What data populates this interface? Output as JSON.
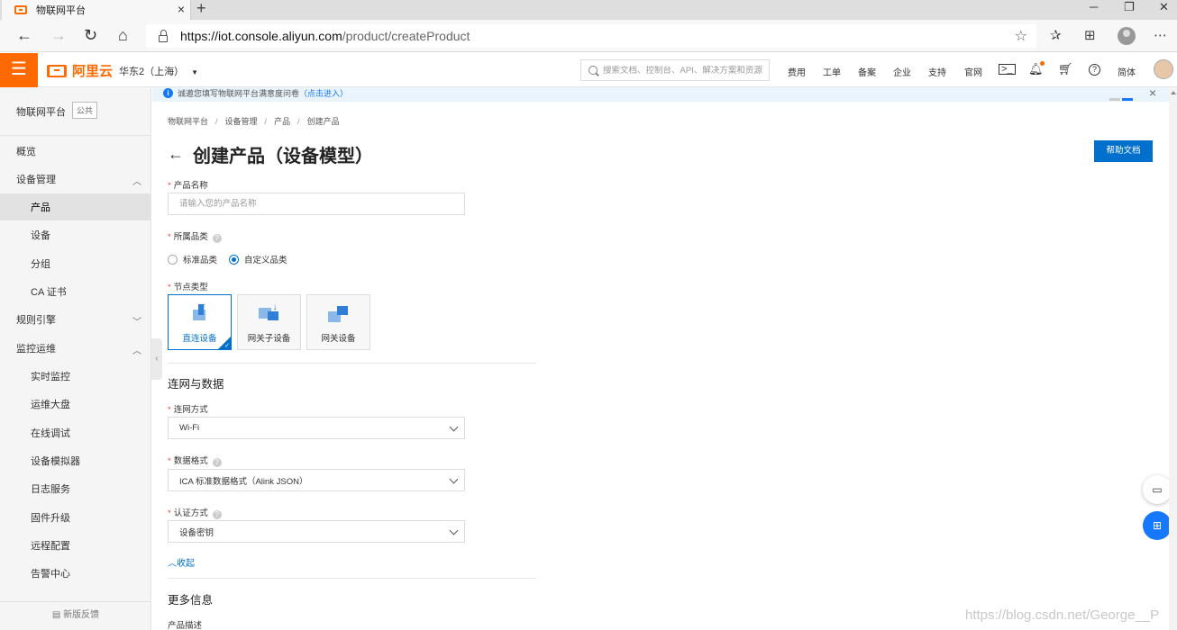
{
  "browser": {
    "tab_title": "物联网平台",
    "tab_close": "×",
    "new_tab": "+",
    "url_host": "https://iot.console.aliyun.com",
    "url_path": "/product/createProduct",
    "win_min": "─",
    "win_restore": "❐",
    "win_close": "✕",
    "nav_back": "←",
    "nav_forward": "→",
    "nav_reload": "↻",
    "nav_home": "⌂",
    "star": "☆",
    "favorites": "✰",
    "collections": "⊞",
    "more": "⋯"
  },
  "header": {
    "hamburger": "☰",
    "logo_text": "阿里云",
    "region": "华东2（上海）",
    "search_placeholder": "搜索文档、控制台、API、解决方案和资源",
    "nav": [
      "费用",
      "工单",
      "备案",
      "企业",
      "支持",
      "官网"
    ],
    "lang": "简体",
    "icons": [
      "terminal-icon",
      "bell-icon",
      "cart-icon",
      "help-icon"
    ]
  },
  "sidebar": {
    "title": "物联网平台",
    "badge": "公共",
    "items": [
      {
        "label": "概览",
        "level": "top"
      },
      {
        "label": "设备管理",
        "level": "top",
        "chevron": "up"
      },
      {
        "label": "产品",
        "level": "sub",
        "active": true
      },
      {
        "label": "设备",
        "level": "sub"
      },
      {
        "label": "分组",
        "level": "sub"
      },
      {
        "label": "CA 证书",
        "level": "sub"
      },
      {
        "label": "规则引擎",
        "level": "top",
        "chevron": "down"
      },
      {
        "label": "监控运维",
        "level": "top",
        "chevron": "up"
      },
      {
        "label": "实时监控",
        "level": "sub"
      },
      {
        "label": "运维大盘",
        "level": "sub"
      },
      {
        "label": "在线调试",
        "level": "sub"
      },
      {
        "label": "设备模拟器",
        "level": "sub"
      },
      {
        "label": "日志服务",
        "level": "sub"
      },
      {
        "label": "固件升级",
        "level": "sub"
      },
      {
        "label": "远程配置",
        "level": "sub"
      },
      {
        "label": "告警中心",
        "level": "sub"
      }
    ],
    "feedback": "新版反馈"
  },
  "banner": {
    "info_glyph": "i",
    "text": "诚邀您填写物联网平台满意度问卷",
    "link": "（点击进入）",
    "close": "×"
  },
  "breadcrumb": [
    "物联网平台",
    "设备管理",
    "产品",
    "创建产品"
  ],
  "page": {
    "back": "←",
    "title": "创建产品（设备模型）",
    "help_button": "帮助文档"
  },
  "form": {
    "product_name_label": "产品名称",
    "product_name_placeholder": "请输入您的产品名称",
    "product_name_value": "",
    "category_label": "所属品类",
    "category_options": [
      {
        "label": "标准品类",
        "selected": false
      },
      {
        "label": "自定义品类",
        "selected": true
      }
    ],
    "node_type_label": "节点类型",
    "node_types": [
      {
        "label": "直连设备",
        "selected": true
      },
      {
        "label": "网关子设备",
        "selected": false
      },
      {
        "label": "网关设备",
        "selected": false
      }
    ],
    "section_network": "连网与数据",
    "network_label": "连网方式",
    "network_value": "Wi-Fi",
    "data_format_label": "数据格式",
    "data_format_value": "ICA 标准数据格式（Alink JSON）",
    "auth_label": "认证方式",
    "auth_value": "设备密钥",
    "collapse_link": "收起",
    "section_more": "更多信息",
    "description_label": "产品描述"
  },
  "watermark": "https://blog.csdn.net/George__P",
  "colors": {
    "brand_orange": "#ff6a00",
    "primary_blue": "#0070cc",
    "required_red": "#e84738"
  }
}
